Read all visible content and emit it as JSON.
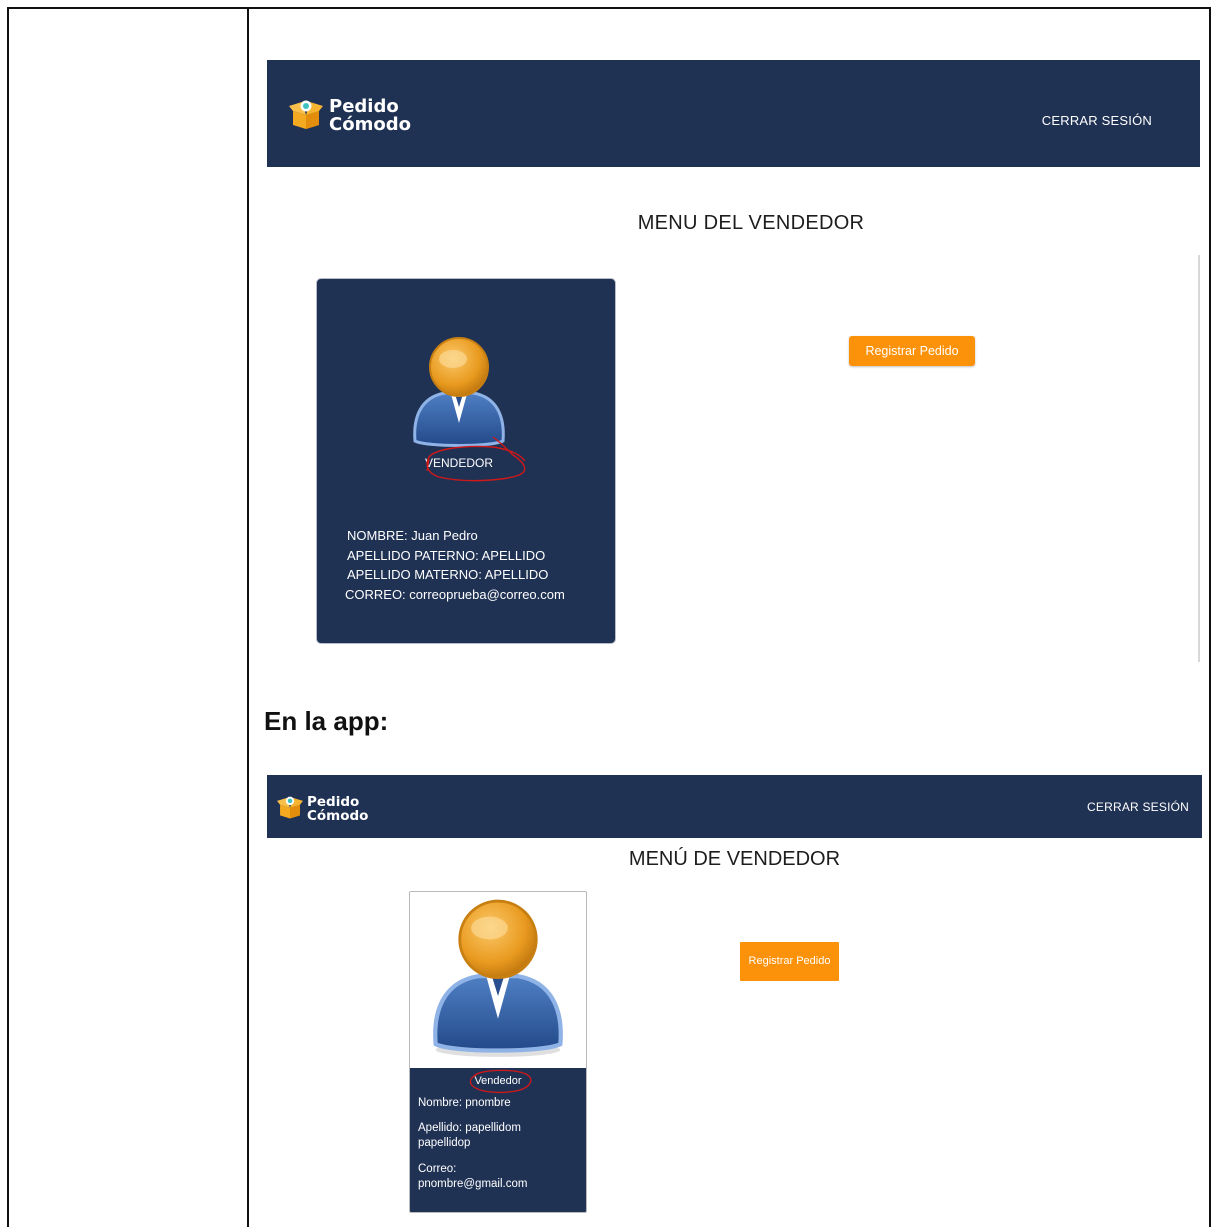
{
  "mockup_design": {
    "brand": {
      "line1": "Pedido",
      "line2": "Cómodo"
    },
    "logout_label": "CERRAR SESIÓN",
    "page_title": "MENU DEL VENDEDOR",
    "card": {
      "role": "VENDEDOR",
      "lines": [
        "NOMBRE: Juan Pedro",
        "APELLIDO PATERNO: APELLIDO",
        "APELLIDO MATERNO: APELLIDO",
        "CORREO: correoprueba@correo.com"
      ]
    },
    "register_button": "Registrar Pedido"
  },
  "caption": "En la app:",
  "mockup_app": {
    "brand": {
      "line1": "Pedido",
      "line2": "Cómodo"
    },
    "logout_label": "CERRAR SESIÓN",
    "page_title": "MENÚ DE VENDEDOR",
    "card": {
      "role": "Vendedor",
      "name_line": "Nombre: pnombre",
      "surname_line": "Apellido: papellidom papellidop",
      "email_line": "Correo: pnombre@gmail.com"
    },
    "register_button": "Registrar Pedido"
  },
  "colors": {
    "navy": "#203254",
    "orange": "#fb9209",
    "annotation_red": "#d01818"
  }
}
